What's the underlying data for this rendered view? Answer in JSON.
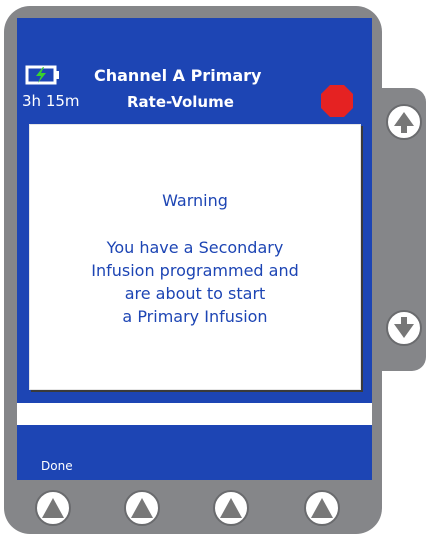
{
  "header": {
    "title": "Channel A Primary",
    "mode": "Rate-Volume",
    "time_remaining": "3h 15m"
  },
  "dialog": {
    "title": "Warning",
    "message_lines": [
      "You have a Secondary",
      "Infusion programmed and",
      "are about to start",
      "a Primary Infusion"
    ]
  },
  "softkeys": {
    "key1_label": "Done"
  },
  "icons": {
    "battery": "battery-charging-icon",
    "stop": "stop-sign-icon",
    "side_up": "up-arrow-icon",
    "side_down": "down-arrow-icon",
    "softkey": "up-triangle-icon"
  },
  "colors": {
    "screen": "#1d45b4",
    "device": "#858689",
    "battery_bolt": "#39d32e",
    "stop": "#e52222"
  }
}
